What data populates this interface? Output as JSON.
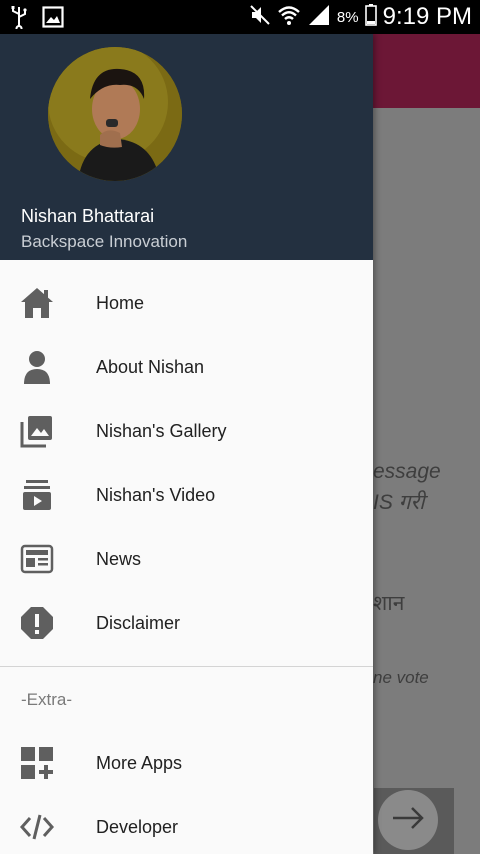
{
  "status_bar": {
    "battery_percent": "8%",
    "time": "9:19 PM",
    "icons": [
      "usb-icon",
      "image-icon",
      "mute-icon",
      "wifi-icon",
      "signal-icon",
      "battery-icon"
    ]
  },
  "background": {
    "text1": "essage",
    "text2": "IS गरी",
    "text3": "शान",
    "text4": "ne vote",
    "appbar_color": "#6c1736"
  },
  "drawer": {
    "header": {
      "name": "Nishan Bhattarai",
      "subtitle": "Backspace Innovation",
      "background_color": "#233040"
    },
    "items": [
      {
        "label": "Home",
        "icon": "home-icon"
      },
      {
        "label": "About Nishan",
        "icon": "person-icon"
      },
      {
        "label": "Nishan's Gallery",
        "icon": "gallery-icon"
      },
      {
        "label": "Nishan's Video",
        "icon": "video-icon"
      },
      {
        "label": "News",
        "icon": "news-icon"
      },
      {
        "label": "Disclaimer",
        "icon": "alert-icon"
      }
    ],
    "extra_section_title": "-Extra-",
    "extra_items": [
      {
        "label": "More Apps",
        "icon": "more-apps-icon"
      },
      {
        "label": "Developer",
        "icon": "code-icon"
      }
    ],
    "icon_color": "#5f5f5f"
  }
}
